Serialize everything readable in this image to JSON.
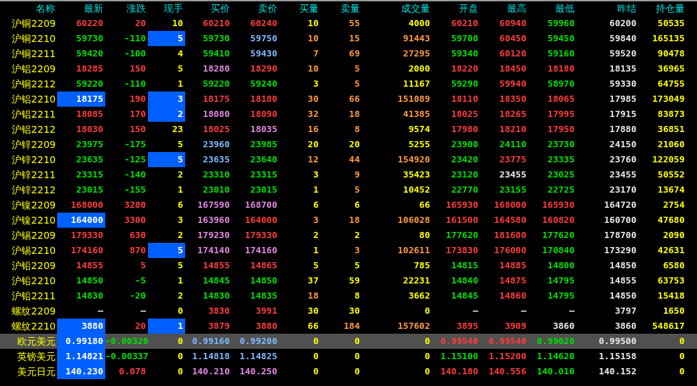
{
  "columns": [
    "名称",
    "最新",
    "涨跌",
    "现手",
    "买价",
    "卖价",
    "买量",
    "卖量",
    "成交量",
    "开盘",
    "最高",
    "最低",
    "昨结",
    "持仓量"
  ],
  "rows": [
    {
      "name": "沪铜2209",
      "selected": false,
      "cells": [
        {
          "text": "60220",
          "color": "#ff3c3c",
          "highlighted": false
        },
        {
          "text": "20",
          "color": "#ff3c3c",
          "highlighted": false
        },
        {
          "text": "10",
          "color": "#ffff00",
          "highlighted": false
        },
        {
          "text": "60210",
          "color": "#ff3c3c",
          "highlighted": false
        },
        {
          "text": "60240",
          "color": "#ff3c3c",
          "highlighted": false
        },
        {
          "text": "10",
          "color": "#ffff00",
          "highlighted": false
        },
        {
          "text": "55",
          "color": "#ff9a40",
          "highlighted": false
        },
        {
          "text": "4000",
          "color": "#ffff00",
          "highlighted": false
        },
        {
          "text": "60210",
          "color": "#ff3c3c",
          "highlighted": false
        },
        {
          "text": "60940",
          "color": "#ff3c3c",
          "highlighted": false
        },
        {
          "text": "59960",
          "color": "#00e000",
          "highlighted": false
        },
        {
          "text": "60200",
          "color": "#e8e8e8",
          "highlighted": false
        },
        {
          "text": "50535",
          "color": "#ffff00",
          "highlighted": false
        }
      ]
    },
    {
      "name": "沪铜2210",
      "selected": false,
      "cells": [
        {
          "text": "59730",
          "color": "#00e000",
          "highlighted": false
        },
        {
          "text": "-110",
          "color": "#00e000",
          "highlighted": false
        },
        {
          "text": "5",
          "color": "#ffffff",
          "highlighted": true
        },
        {
          "text": "59730",
          "color": "#00e000",
          "highlighted": false
        },
        {
          "text": "59750",
          "color": "#80b8ff",
          "highlighted": false
        },
        {
          "text": "10",
          "color": "#ff9a40",
          "highlighted": false
        },
        {
          "text": "15",
          "color": "#ff9a40",
          "highlighted": false
        },
        {
          "text": "91443",
          "color": "#ff9a40",
          "highlighted": false
        },
        {
          "text": "59700",
          "color": "#00e000",
          "highlighted": false
        },
        {
          "text": "60450",
          "color": "#ff3c3c",
          "highlighted": false
        },
        {
          "text": "59450",
          "color": "#00e000",
          "highlighted": false
        },
        {
          "text": "59840",
          "color": "#e8e8e8",
          "highlighted": false
        },
        {
          "text": "165135",
          "color": "#ffff00",
          "highlighted": false
        }
      ]
    },
    {
      "name": "沪铜2211",
      "selected": false,
      "cells": [
        {
          "text": "59420",
          "color": "#00e000",
          "highlighted": false
        },
        {
          "text": "-100",
          "color": "#00e000",
          "highlighted": false
        },
        {
          "text": "4",
          "color": "#ffff00",
          "highlighted": false
        },
        {
          "text": "59410",
          "color": "#00e000",
          "highlighted": false
        },
        {
          "text": "59430",
          "color": "#80b8ff",
          "highlighted": false
        },
        {
          "text": "7",
          "color": "#ff9a40",
          "highlighted": false
        },
        {
          "text": "69",
          "color": "#ff9a40",
          "highlighted": false
        },
        {
          "text": "27295",
          "color": "#ff9a40",
          "highlighted": false
        },
        {
          "text": "59340",
          "color": "#00e000",
          "highlighted": false
        },
        {
          "text": "60120",
          "color": "#ff3c3c",
          "highlighted": false
        },
        {
          "text": "59160",
          "color": "#00e000",
          "highlighted": false
        },
        {
          "text": "59520",
          "color": "#e8e8e8",
          "highlighted": false
        },
        {
          "text": "90478",
          "color": "#ffff00",
          "highlighted": false
        }
      ]
    },
    {
      "name": "沪铝2209",
      "selected": false,
      "cells": [
        {
          "text": "18285",
          "color": "#ff3c3c",
          "highlighted": false
        },
        {
          "text": "150",
          "color": "#ff3c3c",
          "highlighted": false
        },
        {
          "text": "5",
          "color": "#ffff00",
          "highlighted": false
        },
        {
          "text": "18280",
          "color": "#e088e0",
          "highlighted": false
        },
        {
          "text": "18290",
          "color": "#ff3c3c",
          "highlighted": false
        },
        {
          "text": "10",
          "color": "#ff9a40",
          "highlighted": false
        },
        {
          "text": "5",
          "color": "#ff9a40",
          "highlighted": false
        },
        {
          "text": "2000",
          "color": "#ffff00",
          "highlighted": false
        },
        {
          "text": "18220",
          "color": "#ff3c3c",
          "highlighted": false
        },
        {
          "text": "18450",
          "color": "#ff3c3c",
          "highlighted": false
        },
        {
          "text": "18180",
          "color": "#ff3c3c",
          "highlighted": false
        },
        {
          "text": "18135",
          "color": "#e8e8e8",
          "highlighted": false
        },
        {
          "text": "36965",
          "color": "#ffff00",
          "highlighted": false
        }
      ]
    },
    {
      "name": "沪铜2212",
      "selected": false,
      "cells": [
        {
          "text": "59220",
          "color": "#00e000",
          "highlighted": false
        },
        {
          "text": "-110",
          "color": "#00e000",
          "highlighted": false
        },
        {
          "text": "1",
          "color": "#ffff00",
          "highlighted": false
        },
        {
          "text": "59220",
          "color": "#00e000",
          "highlighted": false
        },
        {
          "text": "59240",
          "color": "#00e000",
          "highlighted": false
        },
        {
          "text": "3",
          "color": "#ffff00",
          "highlighted": false
        },
        {
          "text": "5",
          "color": "#ff9a40",
          "highlighted": false
        },
        {
          "text": "11167",
          "color": "#ffff00",
          "highlighted": false
        },
        {
          "text": "59290",
          "color": "#00e000",
          "highlighted": false
        },
        {
          "text": "59940",
          "color": "#ff3c3c",
          "highlighted": false
        },
        {
          "text": "58970",
          "color": "#00e000",
          "highlighted": false
        },
        {
          "text": "59330",
          "color": "#e8e8e8",
          "highlighted": false
        },
        {
          "text": "64755",
          "color": "#ffff00",
          "highlighted": false
        }
      ]
    },
    {
      "name": "沪铝2210",
      "selected": false,
      "cells": [
        {
          "text": "18175",
          "color": "#ffffff",
          "highlighted": true
        },
        {
          "text": "190",
          "color": "#ff3c3c",
          "highlighted": false
        },
        {
          "text": "3",
          "color": "#ffffff",
          "highlighted": true
        },
        {
          "text": "18175",
          "color": "#ff3c3c",
          "highlighted": false
        },
        {
          "text": "18180",
          "color": "#ff3c3c",
          "highlighted": false
        },
        {
          "text": "30",
          "color": "#ff9a40",
          "highlighted": false
        },
        {
          "text": "66",
          "color": "#ff9a40",
          "highlighted": false
        },
        {
          "text": "151089",
          "color": "#ff9a40",
          "highlighted": false
        },
        {
          "text": "18110",
          "color": "#ff3c3c",
          "highlighted": false
        },
        {
          "text": "18350",
          "color": "#ff3c3c",
          "highlighted": false
        },
        {
          "text": "18065",
          "color": "#ff3c3c",
          "highlighted": false
        },
        {
          "text": "17985",
          "color": "#e8e8e8",
          "highlighted": false
        },
        {
          "text": "173049",
          "color": "#ffff00",
          "highlighted": false
        }
      ]
    },
    {
      "name": "沪铝2211",
      "selected": false,
      "cells": [
        {
          "text": "18085",
          "color": "#ff3c3c",
          "highlighted": false
        },
        {
          "text": "170",
          "color": "#ff3c3c",
          "highlighted": false
        },
        {
          "text": "2",
          "color": "#ffffff",
          "highlighted": true
        },
        {
          "text": "18080",
          "color": "#e088e0",
          "highlighted": false
        },
        {
          "text": "18090",
          "color": "#ff3c3c",
          "highlighted": false
        },
        {
          "text": "32",
          "color": "#ff9a40",
          "highlighted": false
        },
        {
          "text": "18",
          "color": "#ff9a40",
          "highlighted": false
        },
        {
          "text": "41385",
          "color": "#ff9a40",
          "highlighted": false
        },
        {
          "text": "18025",
          "color": "#ff3c3c",
          "highlighted": false
        },
        {
          "text": "18265",
          "color": "#ff3c3c",
          "highlighted": false
        },
        {
          "text": "17995",
          "color": "#ff3c3c",
          "highlighted": false
        },
        {
          "text": "17915",
          "color": "#e8e8e8",
          "highlighted": false
        },
        {
          "text": "83873",
          "color": "#ffff00",
          "highlighted": false
        }
      ]
    },
    {
      "name": "沪铝2212",
      "selected": false,
      "cells": [
        {
          "text": "18030",
          "color": "#ff3c3c",
          "highlighted": false
        },
        {
          "text": "150",
          "color": "#ff3c3c",
          "highlighted": false
        },
        {
          "text": "23",
          "color": "#ffff00",
          "highlighted": false
        },
        {
          "text": "18025",
          "color": "#ff3c3c",
          "highlighted": false
        },
        {
          "text": "18035",
          "color": "#e088e0",
          "highlighted": false
        },
        {
          "text": "16",
          "color": "#ff9a40",
          "highlighted": false
        },
        {
          "text": "8",
          "color": "#ff9a40",
          "highlighted": false
        },
        {
          "text": "9574",
          "color": "#ffff00",
          "highlighted": false
        },
        {
          "text": "17980",
          "color": "#ff3c3c",
          "highlighted": false
        },
        {
          "text": "18210",
          "color": "#ff3c3c",
          "highlighted": false
        },
        {
          "text": "17950",
          "color": "#ff3c3c",
          "highlighted": false
        },
        {
          "text": "17880",
          "color": "#e8e8e8",
          "highlighted": false
        },
        {
          "text": "36851",
          "color": "#ffff00",
          "highlighted": false
        }
      ]
    },
    {
      "name": "沪锌2209",
      "selected": false,
      "cells": [
        {
          "text": "23975",
          "color": "#00e000",
          "highlighted": false
        },
        {
          "text": "-175",
          "color": "#00e000",
          "highlighted": false
        },
        {
          "text": "5",
          "color": "#ffff00",
          "highlighted": false
        },
        {
          "text": "23960",
          "color": "#80b8ff",
          "highlighted": false
        },
        {
          "text": "23985",
          "color": "#00e000",
          "highlighted": false
        },
        {
          "text": "20",
          "color": "#ffff00",
          "highlighted": false
        },
        {
          "text": "20",
          "color": "#ffff00",
          "highlighted": false
        },
        {
          "text": "5255",
          "color": "#ffff00",
          "highlighted": false
        },
        {
          "text": "23900",
          "color": "#00e000",
          "highlighted": false
        },
        {
          "text": "24110",
          "color": "#00e000",
          "highlighted": false
        },
        {
          "text": "23730",
          "color": "#00e000",
          "highlighted": false
        },
        {
          "text": "24150",
          "color": "#e8e8e8",
          "highlighted": false
        },
        {
          "text": "21060",
          "color": "#ffff00",
          "highlighted": false
        }
      ]
    },
    {
      "name": "沪锌2210",
      "selected": false,
      "cells": [
        {
          "text": "23635",
          "color": "#00e000",
          "highlighted": false
        },
        {
          "text": "-125",
          "color": "#00e000",
          "highlighted": false
        },
        {
          "text": "5",
          "color": "#ffffff",
          "highlighted": true
        },
        {
          "text": "23635",
          "color": "#80b8ff",
          "highlighted": false
        },
        {
          "text": "23640",
          "color": "#00e000",
          "highlighted": false
        },
        {
          "text": "12",
          "color": "#ff9a40",
          "highlighted": false
        },
        {
          "text": "44",
          "color": "#ff9a40",
          "highlighted": false
        },
        {
          "text": "154920",
          "color": "#ff9a40",
          "highlighted": false
        },
        {
          "text": "23420",
          "color": "#00e000",
          "highlighted": false
        },
        {
          "text": "23775",
          "color": "#ff3c3c",
          "highlighted": false
        },
        {
          "text": "23335",
          "color": "#00e000",
          "highlighted": false
        },
        {
          "text": "23760",
          "color": "#e8e8e8",
          "highlighted": false
        },
        {
          "text": "122059",
          "color": "#ffff00",
          "highlighted": false
        }
      ]
    },
    {
      "name": "沪锌2211",
      "selected": false,
      "cells": [
        {
          "text": "23315",
          "color": "#00e000",
          "highlighted": false
        },
        {
          "text": "-140",
          "color": "#00e000",
          "highlighted": false
        },
        {
          "text": "2",
          "color": "#ffff00",
          "highlighted": false
        },
        {
          "text": "23310",
          "color": "#00e000",
          "highlighted": false
        },
        {
          "text": "23315",
          "color": "#00e000",
          "highlighted": false
        },
        {
          "text": "3",
          "color": "#ffff00",
          "highlighted": false
        },
        {
          "text": "9",
          "color": "#ff9a40",
          "highlighted": false
        },
        {
          "text": "35423",
          "color": "#ffff00",
          "highlighted": false
        },
        {
          "text": "23120",
          "color": "#00e000",
          "highlighted": false
        },
        {
          "text": "23455",
          "color": "#e8e8e8",
          "highlighted": false
        },
        {
          "text": "23025",
          "color": "#00e000",
          "highlighted": false
        },
        {
          "text": "23455",
          "color": "#e8e8e8",
          "highlighted": false
        },
        {
          "text": "50552",
          "color": "#ffff00",
          "highlighted": false
        }
      ]
    },
    {
      "name": "沪锌2212",
      "selected": false,
      "cells": [
        {
          "text": "23015",
          "color": "#00e000",
          "highlighted": false
        },
        {
          "text": "-155",
          "color": "#00e000",
          "highlighted": false
        },
        {
          "text": "1",
          "color": "#ffff00",
          "highlighted": false
        },
        {
          "text": "23010",
          "color": "#00e000",
          "highlighted": false
        },
        {
          "text": "23015",
          "color": "#00e000",
          "highlighted": false
        },
        {
          "text": "1",
          "color": "#ffff00",
          "highlighted": false
        },
        {
          "text": "5",
          "color": "#ff9a40",
          "highlighted": false
        },
        {
          "text": "10452",
          "color": "#ffff00",
          "highlighted": false
        },
        {
          "text": "22770",
          "color": "#00e000",
          "highlighted": false
        },
        {
          "text": "23155",
          "color": "#00e000",
          "highlighted": false
        },
        {
          "text": "22725",
          "color": "#00e000",
          "highlighted": false
        },
        {
          "text": "23170",
          "color": "#e8e8e8",
          "highlighted": false
        },
        {
          "text": "13674",
          "color": "#ffff00",
          "highlighted": false
        }
      ]
    },
    {
      "name": "沪镍2209",
      "selected": false,
      "cells": [
        {
          "text": "168000",
          "color": "#ff3c3c",
          "highlighted": false
        },
        {
          "text": "3280",
          "color": "#ff3c3c",
          "highlighted": false
        },
        {
          "text": "6",
          "color": "#ffff00",
          "highlighted": false
        },
        {
          "text": "167590",
          "color": "#e088e0",
          "highlighted": false
        },
        {
          "text": "168700",
          "color": "#e088e0",
          "highlighted": false
        },
        {
          "text": "6",
          "color": "#ffff00",
          "highlighted": false
        },
        {
          "text": "6",
          "color": "#ffff00",
          "highlighted": false
        },
        {
          "text": "66",
          "color": "#ffff00",
          "highlighted": false
        },
        {
          "text": "165930",
          "color": "#ff3c3c",
          "highlighted": false
        },
        {
          "text": "168000",
          "color": "#ff3c3c",
          "highlighted": false
        },
        {
          "text": "165930",
          "color": "#ff3c3c",
          "highlighted": false
        },
        {
          "text": "164720",
          "color": "#e8e8e8",
          "highlighted": false
        },
        {
          "text": "2754",
          "color": "#ffff00",
          "highlighted": false
        }
      ]
    },
    {
      "name": "沪镍2210",
      "selected": false,
      "cells": [
        {
          "text": "164000",
          "color": "#ffffff",
          "highlighted": true
        },
        {
          "text": "3300",
          "color": "#ff3c3c",
          "highlighted": false
        },
        {
          "text": "3",
          "color": "#ffff00",
          "highlighted": false
        },
        {
          "text": "163960",
          "color": "#e088e0",
          "highlighted": false
        },
        {
          "text": "164000",
          "color": "#ff3c3c",
          "highlighted": false
        },
        {
          "text": "3",
          "color": "#ff9a40",
          "highlighted": false
        },
        {
          "text": "18",
          "color": "#ff9a40",
          "highlighted": false
        },
        {
          "text": "106028",
          "color": "#ff9a40",
          "highlighted": false
        },
        {
          "text": "161500",
          "color": "#ff3c3c",
          "highlighted": false
        },
        {
          "text": "164580",
          "color": "#ff3c3c",
          "highlighted": false
        },
        {
          "text": "160820",
          "color": "#ff3c3c",
          "highlighted": false
        },
        {
          "text": "160700",
          "color": "#e8e8e8",
          "highlighted": false
        },
        {
          "text": "47680",
          "color": "#ffff00",
          "highlighted": false
        }
      ]
    },
    {
      "name": "沪锡2209",
      "selected": false,
      "cells": [
        {
          "text": "179330",
          "color": "#ff3c3c",
          "highlighted": false
        },
        {
          "text": "630",
          "color": "#ff3c3c",
          "highlighted": false
        },
        {
          "text": "2",
          "color": "#ffff00",
          "highlighted": false
        },
        {
          "text": "179230",
          "color": "#e088e0",
          "highlighted": false
        },
        {
          "text": "179330",
          "color": "#ff3c3c",
          "highlighted": false
        },
        {
          "text": "2",
          "color": "#ffff00",
          "highlighted": false
        },
        {
          "text": "2",
          "color": "#ffff00",
          "highlighted": false
        },
        {
          "text": "80",
          "color": "#ffff00",
          "highlighted": false
        },
        {
          "text": "177620",
          "color": "#00e000",
          "highlighted": false
        },
        {
          "text": "181600",
          "color": "#ff3c3c",
          "highlighted": false
        },
        {
          "text": "177620",
          "color": "#00e000",
          "highlighted": false
        },
        {
          "text": "178700",
          "color": "#e8e8e8",
          "highlighted": false
        },
        {
          "text": "2090",
          "color": "#ffff00",
          "highlighted": false
        }
      ]
    },
    {
      "name": "沪锡2210",
      "selected": false,
      "cells": [
        {
          "text": "174160",
          "color": "#ff3c3c",
          "highlighted": false
        },
        {
          "text": "870",
          "color": "#ff3c3c",
          "highlighted": false
        },
        {
          "text": "5",
          "color": "#ffffff",
          "highlighted": true
        },
        {
          "text": "174140",
          "color": "#e088e0",
          "highlighted": false
        },
        {
          "text": "174160",
          "color": "#e088e0",
          "highlighted": false
        },
        {
          "text": "1",
          "color": "#ffff00",
          "highlighted": false
        },
        {
          "text": "3",
          "color": "#ff9a40",
          "highlighted": false
        },
        {
          "text": "102611",
          "color": "#ff9a40",
          "highlighted": false
        },
        {
          "text": "173830",
          "color": "#ff3c3c",
          "highlighted": false
        },
        {
          "text": "176000",
          "color": "#ff3c3c",
          "highlighted": false
        },
        {
          "text": "170840",
          "color": "#00e000",
          "highlighted": false
        },
        {
          "text": "173290",
          "color": "#e8e8e8",
          "highlighted": false
        },
        {
          "text": "42631",
          "color": "#ffff00",
          "highlighted": false
        }
      ]
    },
    {
      "name": "沪铅2209",
      "selected": false,
      "cells": [
        {
          "text": "14855",
          "color": "#ff3c3c",
          "highlighted": false
        },
        {
          "text": "5",
          "color": "#ff3c3c",
          "highlighted": false
        },
        {
          "text": "5",
          "color": "#ffff00",
          "highlighted": false
        },
        {
          "text": "14855",
          "color": "#ff3c3c",
          "highlighted": false
        },
        {
          "text": "14865",
          "color": "#ff3c3c",
          "highlighted": false
        },
        {
          "text": "5",
          "color": "#ffff00",
          "highlighted": false
        },
        {
          "text": "5",
          "color": "#ffff00",
          "highlighted": false
        },
        {
          "text": "785",
          "color": "#ffff00",
          "highlighted": false
        },
        {
          "text": "14815",
          "color": "#00e000",
          "highlighted": false
        },
        {
          "text": "14885",
          "color": "#ff3c3c",
          "highlighted": false
        },
        {
          "text": "14800",
          "color": "#00e000",
          "highlighted": false
        },
        {
          "text": "14850",
          "color": "#e8e8e8",
          "highlighted": false
        },
        {
          "text": "6580",
          "color": "#ffff00",
          "highlighted": false
        }
      ]
    },
    {
      "name": "沪铅2210",
      "selected": false,
      "cells": [
        {
          "text": "14850",
          "color": "#00e000",
          "highlighted": false
        },
        {
          "text": "-5",
          "color": "#00e000",
          "highlighted": false
        },
        {
          "text": "1",
          "color": "#ffff00",
          "highlighted": false
        },
        {
          "text": "14845",
          "color": "#00e000",
          "highlighted": false
        },
        {
          "text": "14850",
          "color": "#00e000",
          "highlighted": false
        },
        {
          "text": "37",
          "color": "#ffff00",
          "highlighted": false
        },
        {
          "text": "59",
          "color": "#ffff00",
          "highlighted": false
        },
        {
          "text": "22231",
          "color": "#ffff00",
          "highlighted": false
        },
        {
          "text": "14840",
          "color": "#00e000",
          "highlighted": false
        },
        {
          "text": "14875",
          "color": "#ff3c3c",
          "highlighted": false
        },
        {
          "text": "14795",
          "color": "#00e000",
          "highlighted": false
        },
        {
          "text": "14855",
          "color": "#e8e8e8",
          "highlighted": false
        },
        {
          "text": "63753",
          "color": "#ffff00",
          "highlighted": false
        }
      ]
    },
    {
      "name": "沪铅2211",
      "selected": false,
      "cells": [
        {
          "text": "14830",
          "color": "#00e000",
          "highlighted": false
        },
        {
          "text": "-20",
          "color": "#00e000",
          "highlighted": false
        },
        {
          "text": "2",
          "color": "#ffff00",
          "highlighted": false
        },
        {
          "text": "14830",
          "color": "#00e000",
          "highlighted": false
        },
        {
          "text": "14835",
          "color": "#00e000",
          "highlighted": false
        },
        {
          "text": "18",
          "color": "#ff9a40",
          "highlighted": false
        },
        {
          "text": "8",
          "color": "#ffff00",
          "highlighted": false
        },
        {
          "text": "3662",
          "color": "#ffff00",
          "highlighted": false
        },
        {
          "text": "14845",
          "color": "#00e000",
          "highlighted": false
        },
        {
          "text": "14860",
          "color": "#ff3c3c",
          "highlighted": false
        },
        {
          "text": "14795",
          "color": "#00e000",
          "highlighted": false
        },
        {
          "text": "14850",
          "color": "#e8e8e8",
          "highlighted": false
        },
        {
          "text": "15418",
          "color": "#ffff00",
          "highlighted": false
        }
      ]
    },
    {
      "name": "螺纹2209",
      "selected": false,
      "cells": [
        {
          "text": "—",
          "color": "#e8e8e8",
          "highlighted": false
        },
        {
          "text": "—",
          "color": "#e8e8e8",
          "highlighted": false
        },
        {
          "text": "0",
          "color": "#ffff00",
          "highlighted": false
        },
        {
          "text": "3830",
          "color": "#ff3c3c",
          "highlighted": false
        },
        {
          "text": "3991",
          "color": "#ff3c3c",
          "highlighted": false
        },
        {
          "text": "30",
          "color": "#ffff00",
          "highlighted": false
        },
        {
          "text": "30",
          "color": "#ffff00",
          "highlighted": false
        },
        {
          "text": "0",
          "color": "#ffff00",
          "highlighted": false
        },
        {
          "text": "—",
          "color": "#e8e8e8",
          "highlighted": false
        },
        {
          "text": "—",
          "color": "#e8e8e8",
          "highlighted": false
        },
        {
          "text": "—",
          "color": "#e8e8e8",
          "highlighted": false
        },
        {
          "text": "3797",
          "color": "#e8e8e8",
          "highlighted": false
        },
        {
          "text": "1650",
          "color": "#ffff00",
          "highlighted": false
        }
      ]
    },
    {
      "name": "螺纹2210",
      "selected": false,
      "cells": [
        {
          "text": "3880",
          "color": "#ffffff",
          "highlighted": true
        },
        {
          "text": "20",
          "color": "#ff3c3c",
          "highlighted": false
        },
        {
          "text": "1",
          "color": "#ffffff",
          "highlighted": true
        },
        {
          "text": "3879",
          "color": "#ff3c3c",
          "highlighted": false
        },
        {
          "text": "3880",
          "color": "#ff3c3c",
          "highlighted": false
        },
        {
          "text": "66",
          "color": "#ffff00",
          "highlighted": false
        },
        {
          "text": "184",
          "color": "#ff9a40",
          "highlighted": false
        },
        {
          "text": "157602",
          "color": "#ff9a40",
          "highlighted": false
        },
        {
          "text": "3895",
          "color": "#ff3c3c",
          "highlighted": false
        },
        {
          "text": "3909",
          "color": "#ff3c3c",
          "highlighted": false
        },
        {
          "text": "3860",
          "color": "#e8e8e8",
          "highlighted": false
        },
        {
          "text": "3860",
          "color": "#e8e8e8",
          "highlighted": false
        },
        {
          "text": "548617",
          "color": "#ffff00",
          "highlighted": false
        }
      ]
    },
    {
      "name": "欧元美元",
      "selected": true,
      "cells": [
        {
          "text": "0.99180",
          "color": "#ffffff",
          "highlighted": true
        },
        {
          "text": "-0.00320",
          "color": "#00e000",
          "highlighted": false
        },
        {
          "text": "0",
          "color": "#ffff00",
          "highlighted": false
        },
        {
          "text": "0.99160",
          "color": "#80b8ff",
          "highlighted": false
        },
        {
          "text": "0.99200",
          "color": "#80b8ff",
          "highlighted": false
        },
        {
          "text": "0",
          "color": "#ffff00",
          "highlighted": false
        },
        {
          "text": "0",
          "color": "#ffff00",
          "highlighted": false
        },
        {
          "text": "0",
          "color": "#ffff00",
          "highlighted": false
        },
        {
          "text": "0.99540",
          "color": "#ff3c3c",
          "highlighted": false
        },
        {
          "text": "0.99540",
          "color": "#ff3c3c",
          "highlighted": false
        },
        {
          "text": "0.99020",
          "color": "#00e000",
          "highlighted": false
        },
        {
          "text": "0.99500",
          "color": "#e8e8e8",
          "highlighted": false
        },
        {
          "text": "0",
          "color": "#ffff00",
          "highlighted": false
        }
      ]
    },
    {
      "name": "英镑美元",
      "selected": false,
      "cells": [
        {
          "text": "1.14821",
          "color": "#ffffff",
          "highlighted": true
        },
        {
          "text": "-0.00337",
          "color": "#00e000",
          "highlighted": false
        },
        {
          "text": "0",
          "color": "#ffff00",
          "highlighted": false
        },
        {
          "text": "1.14818",
          "color": "#80b8ff",
          "highlighted": false
        },
        {
          "text": "1.14825",
          "color": "#80b8ff",
          "highlighted": false
        },
        {
          "text": "0",
          "color": "#ffff00",
          "highlighted": false
        },
        {
          "text": "0",
          "color": "#ffff00",
          "highlighted": false
        },
        {
          "text": "0",
          "color": "#ffff00",
          "highlighted": false
        },
        {
          "text": "1.15100",
          "color": "#00e000",
          "highlighted": false
        },
        {
          "text": "1.15200",
          "color": "#ff3c3c",
          "highlighted": false
        },
        {
          "text": "1.14620",
          "color": "#00e000",
          "highlighted": false
        },
        {
          "text": "1.15158",
          "color": "#e8e8e8",
          "highlighted": false
        },
        {
          "text": "0",
          "color": "#ffff00",
          "highlighted": false
        }
      ]
    },
    {
      "name": "美元日元",
      "selected": false,
      "cells": [
        {
          "text": "140.230",
          "color": "#ffffff",
          "highlighted": true
        },
        {
          "text": "0.078",
          "color": "#ff3c3c",
          "highlighted": false
        },
        {
          "text": "0",
          "color": "#ffff00",
          "highlighted": false
        },
        {
          "text": "140.210",
          "color": "#e088e0",
          "highlighted": false
        },
        {
          "text": "140.250",
          "color": "#e088e0",
          "highlighted": false
        },
        {
          "text": "0",
          "color": "#ffff00",
          "highlighted": false
        },
        {
          "text": "0",
          "color": "#ffff00",
          "highlighted": false
        },
        {
          "text": "0",
          "color": "#ffff00",
          "highlighted": false
        },
        {
          "text": "140.180",
          "color": "#ff3c3c",
          "highlighted": false
        },
        {
          "text": "140.556",
          "color": "#ff3c3c",
          "highlighted": false
        },
        {
          "text": "140.010",
          "color": "#00e000",
          "highlighted": false
        },
        {
          "text": "140.152",
          "color": "#e8e8e8",
          "highlighted": false
        },
        {
          "text": "0",
          "color": "#ffff00",
          "highlighted": false
        }
      ]
    }
  ]
}
